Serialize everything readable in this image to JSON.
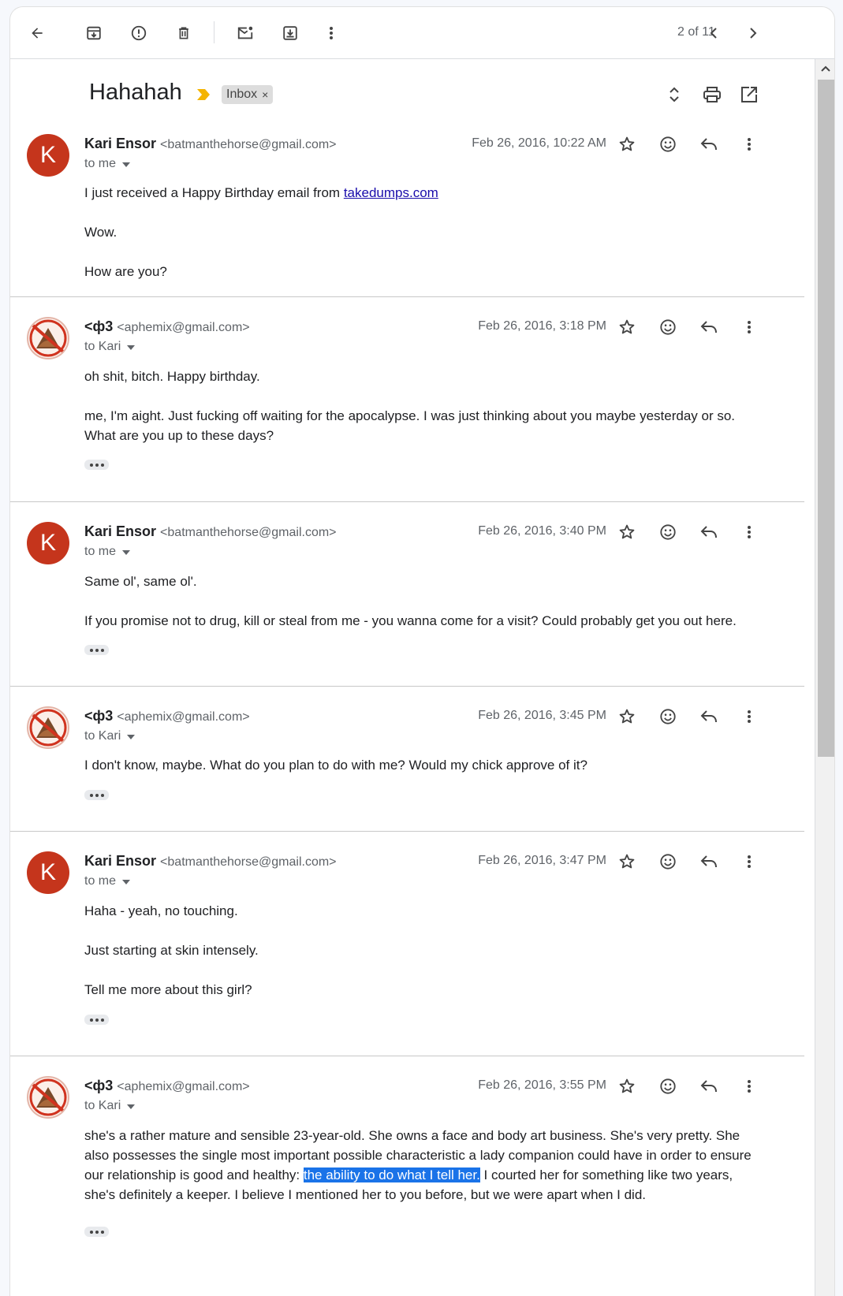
{
  "toolbar": {
    "icons": [
      "back-arrow-icon",
      "archive-icon",
      "report-spam-icon",
      "delete-icon",
      "mark-unread-icon",
      "move-to-icon",
      "more-vertical-icon"
    ],
    "pager": "2 of 11"
  },
  "thread": {
    "subject": "Hahahah",
    "label": "Inbox",
    "label_remove": "×"
  },
  "messages": [
    {
      "avatar": "K",
      "name": "Kari Ensor",
      "email": "<batmanthehorse@gmail.com>",
      "recipient": "to me",
      "date": "Feb 26, 2016, 10:22 AM",
      "body": [
        "I just received a Happy Birthday email from ",
        "Wow.",
        "How are you?"
      ],
      "link": "takedumps.com"
    },
    {
      "avatar": "",
      "name": "<ф3",
      "email": "<aphemix@gmail.com>",
      "recipient": "to Kari",
      "date": "Feb 26, 2016, 3:18 PM",
      "body": [
        "oh shit, bitch. Happy birthday.",
        "me, I'm aight. Just fucking off waiting for the apocalypse. I was just thinking about you maybe yesterday or so. What are you up to these days?"
      ]
    },
    {
      "avatar": "K",
      "name": "Kari Ensor",
      "email": "<batmanthehorse@gmail.com>",
      "recipient": "to me",
      "date": "Feb 26, 2016, 3:40 PM",
      "body": [
        "Same ol', same ol'.",
        "If you promise not to drug, kill or steal from me - you wanna come for a visit? Could probably get you out here."
      ]
    },
    {
      "avatar": "",
      "name": "<ф3",
      "email": "<aphemix@gmail.com>",
      "recipient": "to Kari",
      "date": "Feb 26, 2016, 3:45 PM",
      "body": [
        "I don't know, maybe. What do you plan to do with me? Would my chick approve of it?"
      ]
    },
    {
      "avatar": "K",
      "name": "Kari Ensor",
      "email": "<batmanthehorse@gmail.com>",
      "recipient": "to me",
      "date": "Feb 26, 2016, 3:47 PM",
      "body": [
        "Haha - yeah, no touching.",
        "Just starting at skin intensely.",
        "Tell me more about this girl?"
      ]
    },
    {
      "avatar": "",
      "name": "<ф3",
      "email": "<aphemix@gmail.com>",
      "recipient": "to Kari",
      "date": "Feb 26, 2016, 3:55 PM",
      "body_before": "she's a rather mature and sensible 23-year-old. She owns a face and body art business. She's very pretty. She also possesses the single most important possible characteristic a lady companion could have in order to ensure our relationship is good and healthy: ",
      "body_highlight": "the ability to do what I tell her.",
      "body_after": " I courted her for something like two years, she's definitely a keeper. I believe I mentioned her to you before, but we were apart when I did."
    }
  ],
  "colors": {
    "avatar_k": "#c5351c",
    "highlight": "#1a73e8",
    "importance": "#f4b400",
    "link": "#1a0dab"
  }
}
